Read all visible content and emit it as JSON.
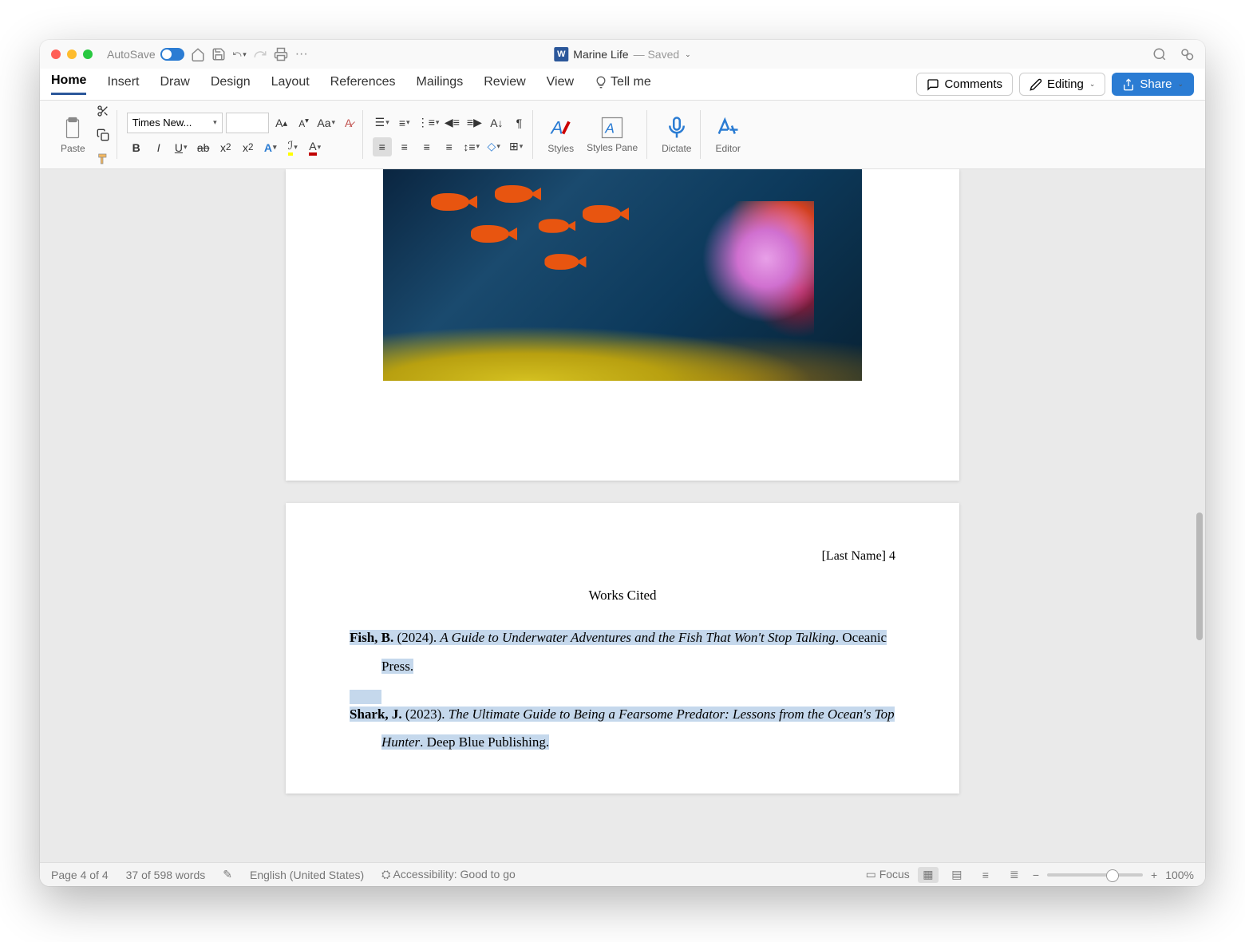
{
  "titlebar": {
    "autosave": "AutoSave",
    "docname": "Marine Life",
    "saved": "— Saved"
  },
  "tabs": {
    "home": "Home",
    "insert": "Insert",
    "draw": "Draw",
    "design": "Design",
    "layout": "Layout",
    "references": "References",
    "mailings": "Mailings",
    "review": "Review",
    "view": "View",
    "tellme": "Tell me"
  },
  "buttons": {
    "comments": "Comments",
    "editing": "Editing",
    "share": "Share"
  },
  "ribbon": {
    "paste": "Paste",
    "font": "Times New...",
    "styles": "Styles",
    "stylespane": "Styles Pane",
    "dictate": "Dictate",
    "editor": "Editor"
  },
  "doc": {
    "header": "[Last Name] 4",
    "works_cited": "Works Cited",
    "cite1": {
      "author": "Fish, B.",
      "year": " (2024). ",
      "title": "A Guide to Underwater Adventures and the Fish That Won't Stop Talking",
      "pub": ". Oceanic Press."
    },
    "cite2": {
      "author": "Shark, J.",
      "year": " (2023). ",
      "title": "The Ultimate Guide to Being a Fearsome Predator: Lessons from the Ocean's Top Hunter",
      "pub": ". Deep Blue Publishing."
    }
  },
  "status": {
    "page": "Page 4 of 4",
    "words": "37 of 598 words",
    "lang": "English (United States)",
    "acc": "Accessibility: Good to go",
    "focus": "Focus",
    "zoom": "100%"
  }
}
